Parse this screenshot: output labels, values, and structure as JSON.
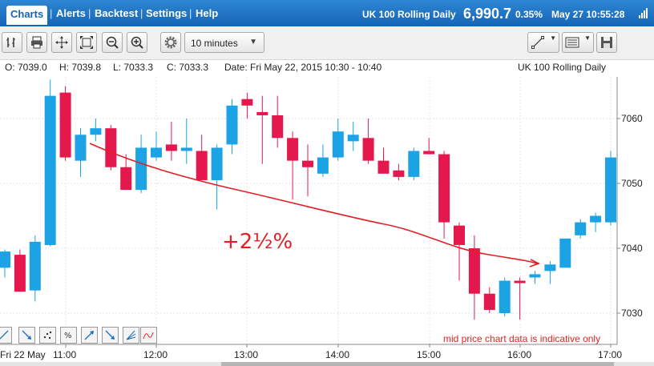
{
  "nav": {
    "tabs": [
      "Charts",
      "Alerts",
      "Backtest",
      "Settings",
      "Help"
    ]
  },
  "header": {
    "instrument": "UK 100 Rolling Daily",
    "price": "6,990.7",
    "change_pct": "0.35%",
    "datetime": "May 27 10:55:28"
  },
  "toolbar": {
    "interval": "10 minutes"
  },
  "ohlc": {
    "open": "O: 7039.0",
    "high": "H: 7039.8",
    "low": "L: 7033.3",
    "close": "C: 7033.3",
    "date": "Date: Fri May 22, 2015 10:30 - 10:40",
    "instrument": "UK 100 Rolling Daily"
  },
  "chart_data": {
    "type": "candlestick",
    "x_tick_labels": [
      "Fri 22 May",
      "11:00",
      "12:00",
      "13:00",
      "14:00",
      "15:00",
      "16:00",
      "17:00"
    ],
    "y_ticks": [
      7030,
      7040,
      7050,
      7060
    ],
    "ylim": [
      7027,
      7073
    ],
    "up_color": "#1ba3e6",
    "down_color": "#e5184d",
    "candles": [
      {
        "o": 7037.0,
        "h": 7039.8,
        "l": 7035.5,
        "c": 7039.5,
        "up": true
      },
      {
        "o": 7039.0,
        "h": 7039.8,
        "l": 7033.3,
        "c": 7033.3,
        "up": false
      },
      {
        "o": 7033.5,
        "h": 7042.0,
        "l": 7031.8,
        "c": 7041.0,
        "up": true
      },
      {
        "o": 7040.5,
        "h": 7066.0,
        "l": 7040.3,
        "c": 7063.5,
        "up": true
      },
      {
        "o": 7064.0,
        "h": 7065.0,
        "l": 7053.5,
        "c": 7054.0,
        "up": false
      },
      {
        "o": 7053.5,
        "h": 7058.5,
        "l": 7051.0,
        "c": 7057.5,
        "up": true
      },
      {
        "o": 7057.5,
        "h": 7060.0,
        "l": 7056.5,
        "c": 7058.5,
        "up": true
      },
      {
        "o": 7058.5,
        "h": 7059.0,
        "l": 7052.0,
        "c": 7052.5,
        "up": false
      },
      {
        "o": 7052.5,
        "h": 7054.5,
        "l": 7049.0,
        "c": 7049.0,
        "up": false
      },
      {
        "o": 7049.0,
        "h": 7057.5,
        "l": 7048.5,
        "c": 7055.5,
        "up": true
      },
      {
        "o": 7054.0,
        "h": 7058.0,
        "l": 7053.5,
        "c": 7055.5,
        "up": true
      },
      {
        "o": 7056.0,
        "h": 7059.5,
        "l": 7053.5,
        "c": 7055.0,
        "up": false
      },
      {
        "o": 7055.0,
        "h": 7060.0,
        "l": 7053.0,
        "c": 7055.5,
        "up": true
      },
      {
        "o": 7055.0,
        "h": 7057.5,
        "l": 7050.5,
        "c": 7050.5,
        "up": false
      },
      {
        "o": 7050.5,
        "h": 7056.0,
        "l": 7046.0,
        "c": 7055.5,
        "up": true
      },
      {
        "o": 7056.0,
        "h": 7063.0,
        "l": 7054.5,
        "c": 7062.0,
        "up": true
      },
      {
        "o": 7063.0,
        "h": 7064.0,
        "l": 7060.0,
        "c": 7062.0,
        "up": false
      },
      {
        "o": 7061.0,
        "h": 7063.5,
        "l": 7053.0,
        "c": 7060.5,
        "up": false
      },
      {
        "o": 7060.5,
        "h": 7063.5,
        "l": 7055.5,
        "c": 7057.0,
        "up": false
      },
      {
        "o": 7057.0,
        "h": 7058.0,
        "l": 7047.5,
        "c": 7053.5,
        "up": false
      },
      {
        "o": 7053.5,
        "h": 7056.0,
        "l": 7048.0,
        "c": 7052.5,
        "up": false
      },
      {
        "o": 7051.5,
        "h": 7056.0,
        "l": 7051.0,
        "c": 7054.0,
        "up": true
      },
      {
        "o": 7054.0,
        "h": 7060.0,
        "l": 7053.5,
        "c": 7058.0,
        "up": true
      },
      {
        "o": 7057.5,
        "h": 7059.5,
        "l": 7055.0,
        "c": 7056.5,
        "up": true
      },
      {
        "o": 7057.0,
        "h": 7060.0,
        "l": 7053.0,
        "c": 7053.5,
        "up": false
      },
      {
        "o": 7053.5,
        "h": 7055.5,
        "l": 7051.5,
        "c": 7051.5,
        "up": false
      },
      {
        "o": 7052.0,
        "h": 7053.0,
        "l": 7050.5,
        "c": 7051.0,
        "up": false
      },
      {
        "o": 7051.0,
        "h": 7055.5,
        "l": 7050.5,
        "c": 7055.0,
        "up": true
      },
      {
        "o": 7055.0,
        "h": 7057.0,
        "l": 7054.5,
        "c": 7054.5,
        "up": false
      },
      {
        "o": 7054.5,
        "h": 7055.0,
        "l": 7041.5,
        "c": 7044.0,
        "up": false
      },
      {
        "o": 7043.5,
        "h": 7044.0,
        "l": 7035.0,
        "c": 7040.5,
        "up": false
      },
      {
        "o": 7040.0,
        "h": 7042.0,
        "l": 7029.0,
        "c": 7033.0,
        "up": false
      },
      {
        "o": 7033.0,
        "h": 7034.0,
        "l": 7030.0,
        "c": 7030.5,
        "up": false
      },
      {
        "o": 7030.0,
        "h": 7035.5,
        "l": 7029.5,
        "c": 7035.0,
        "up": true
      },
      {
        "o": 7035.0,
        "h": 7035.5,
        "l": 7029.0,
        "c": 7035.0,
        "up": false
      },
      {
        "o": 7035.5,
        "h": 7036.5,
        "l": 7034.5,
        "c": 7036.0,
        "up": true
      },
      {
        "o": 7036.5,
        "h": 7038.0,
        "l": 7034.5,
        "c": 7037.5,
        "up": true
      },
      {
        "o": 7037.0,
        "h": 7041.5,
        "l": 7037.0,
        "c": 7041.5,
        "up": true
      },
      {
        "o": 7042.0,
        "h": 7044.5,
        "l": 7041.5,
        "c": 7044.0,
        "up": true
      },
      {
        "o": 7044.0,
        "h": 7045.5,
        "l": 7042.5,
        "c": 7045.0,
        "up": true
      },
      {
        "o": 7044.0,
        "h": 7055.0,
        "l": 7043.5,
        "c": 7054.0,
        "up": true
      }
    ],
    "annotation_text": "+2½%",
    "trend_line_color": "#e51e25"
  },
  "footer": {
    "note": "mid price chart data is indicative only"
  }
}
